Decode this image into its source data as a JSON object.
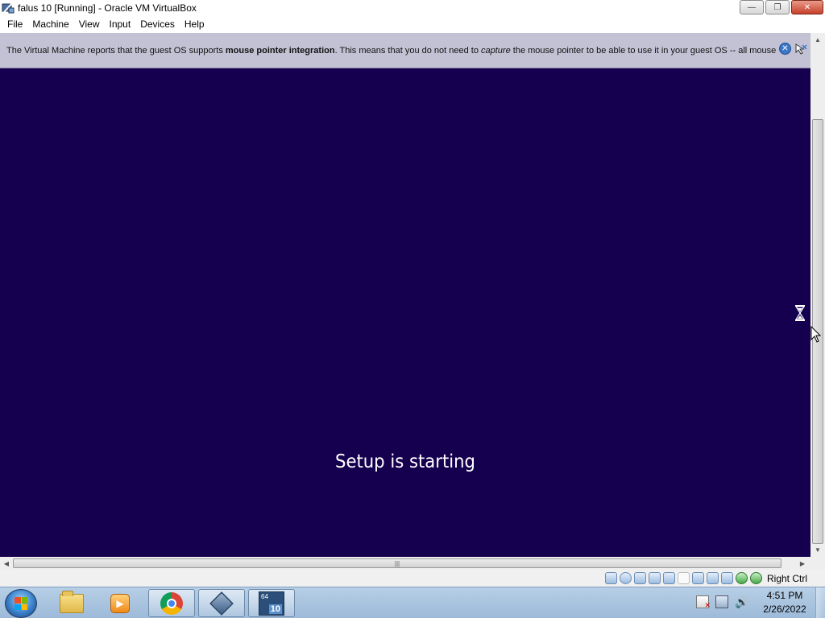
{
  "window": {
    "title": "falus 10 [Running] - Oracle VM VirtualBox",
    "minimize_label": "—",
    "restore_label": "❐",
    "close_label": "✕"
  },
  "menubar": {
    "items": [
      {
        "label": "File"
      },
      {
        "label": "Machine"
      },
      {
        "label": "View"
      },
      {
        "label": "Input"
      },
      {
        "label": "Devices"
      },
      {
        "label": "Help"
      }
    ]
  },
  "notice": {
    "part1": "The Virtual Machine reports that the guest OS supports ",
    "bold": "mouse pointer integration",
    "part2": ". This means that you do not need to ",
    "italic": "capture",
    "part3": " the mouse pointer to be able to use it in your guest OS -- all mouse",
    "close_label": "✕"
  },
  "vm_screen": {
    "background": "#15004f",
    "setup_text": "Setup is starting"
  },
  "scrollbars": {
    "up": "▲",
    "down": "▼",
    "left": "◀",
    "right": "▶",
    "grip": "|||"
  },
  "statusbar": {
    "icons": [
      "hard-disk-icon",
      "optical-drive-icon",
      "audio-icon",
      "network-icon",
      "usb-icon",
      "shared-folder-icon",
      "display-icon",
      "video-capture-icon",
      "virtualization-icon",
      "mouse-integration-icon",
      "keyboard-icon"
    ],
    "host_key": "Right Ctrl"
  },
  "taskbar": {
    "apps": [
      "Windows Explorer",
      "Windows Media Player",
      "Google Chrome",
      "Oracle VM VirtualBox",
      "falus 10 VM"
    ],
    "vm_badge_top": "64",
    "vm_badge_bottom": "10",
    "time": "4:51 PM",
    "date": "2/26/2022",
    "volume_glyph": "🔊"
  },
  "colors": {
    "vm_background": "#15004f",
    "notice_background": "#c2c2d4",
    "taskbar": "#a9c4e0"
  }
}
